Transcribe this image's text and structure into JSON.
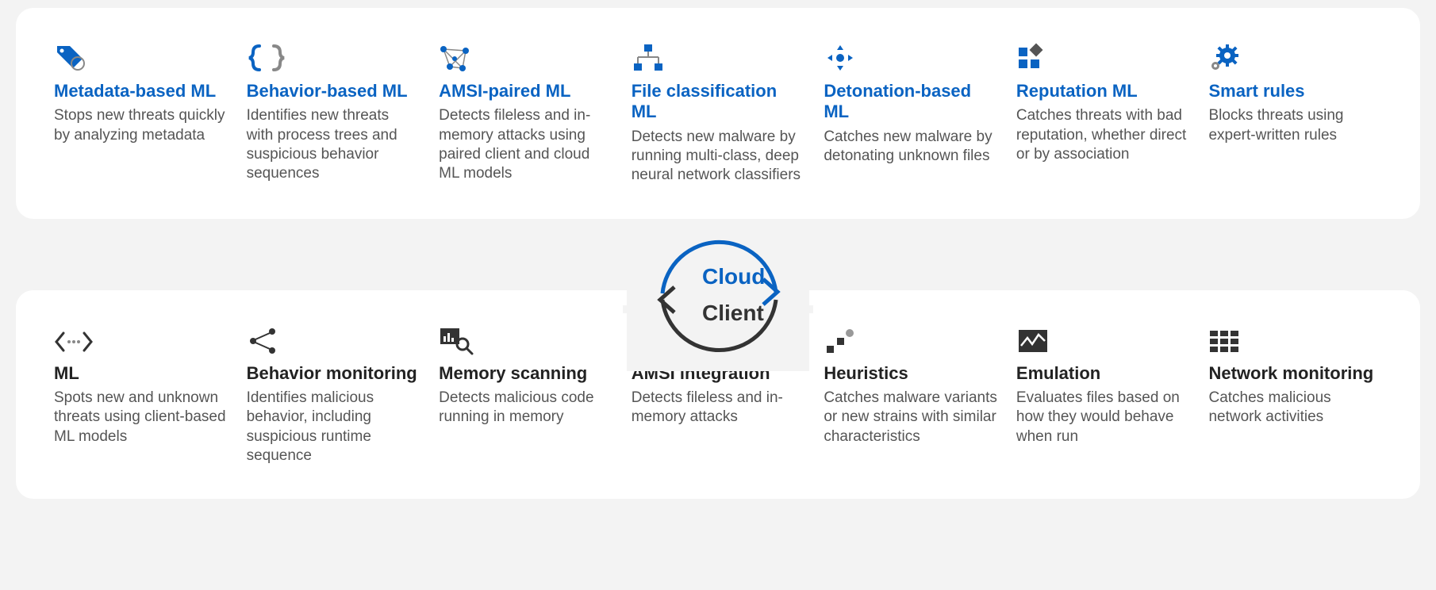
{
  "cycle": {
    "top_label": "Cloud",
    "bottom_label": "Client"
  },
  "cloud": {
    "items": [
      {
        "title": "Metadata-based ML",
        "desc": "Stops new threats quickly by analyzing metadata"
      },
      {
        "title": "Behavior-based ML",
        "desc": "Identifies new threats with process trees and suspicious behavior sequences"
      },
      {
        "title": "AMSI-paired ML",
        "desc": "Detects fileless and in-memory attacks using paired client and cloud ML models"
      },
      {
        "title": "File classification ML",
        "desc": "Detects new malware by running multi-class, deep neural network classifiers"
      },
      {
        "title": "Detonation-based ML",
        "desc": "Catches new malware by detonating unknown files"
      },
      {
        "title": "Reputation ML",
        "desc": "Catches threats with bad reputation, whether direct or by association"
      },
      {
        "title": "Smart rules",
        "desc": "Blocks threats using expert-written rules"
      }
    ]
  },
  "client": {
    "items": [
      {
        "title": "ML",
        "desc": "Spots new and unknown threats using client-based ML models"
      },
      {
        "title": "Behavior monitoring",
        "desc": "Identifies malicious behavior, including suspicious runtime sequence"
      },
      {
        "title": "Memory scanning",
        "desc": "Detects malicious code running in memory"
      },
      {
        "title": "AMSI integration",
        "desc": "Detects fileless and in-memory attacks"
      },
      {
        "title": "Heuristics",
        "desc": "Catches malware variants or new strains with similar characteristics"
      },
      {
        "title": "Emulation",
        "desc": "Evaluates files based on how they would behave when run"
      },
      {
        "title": "Network monitoring",
        "desc": "Catches malicious network activities"
      }
    ]
  }
}
